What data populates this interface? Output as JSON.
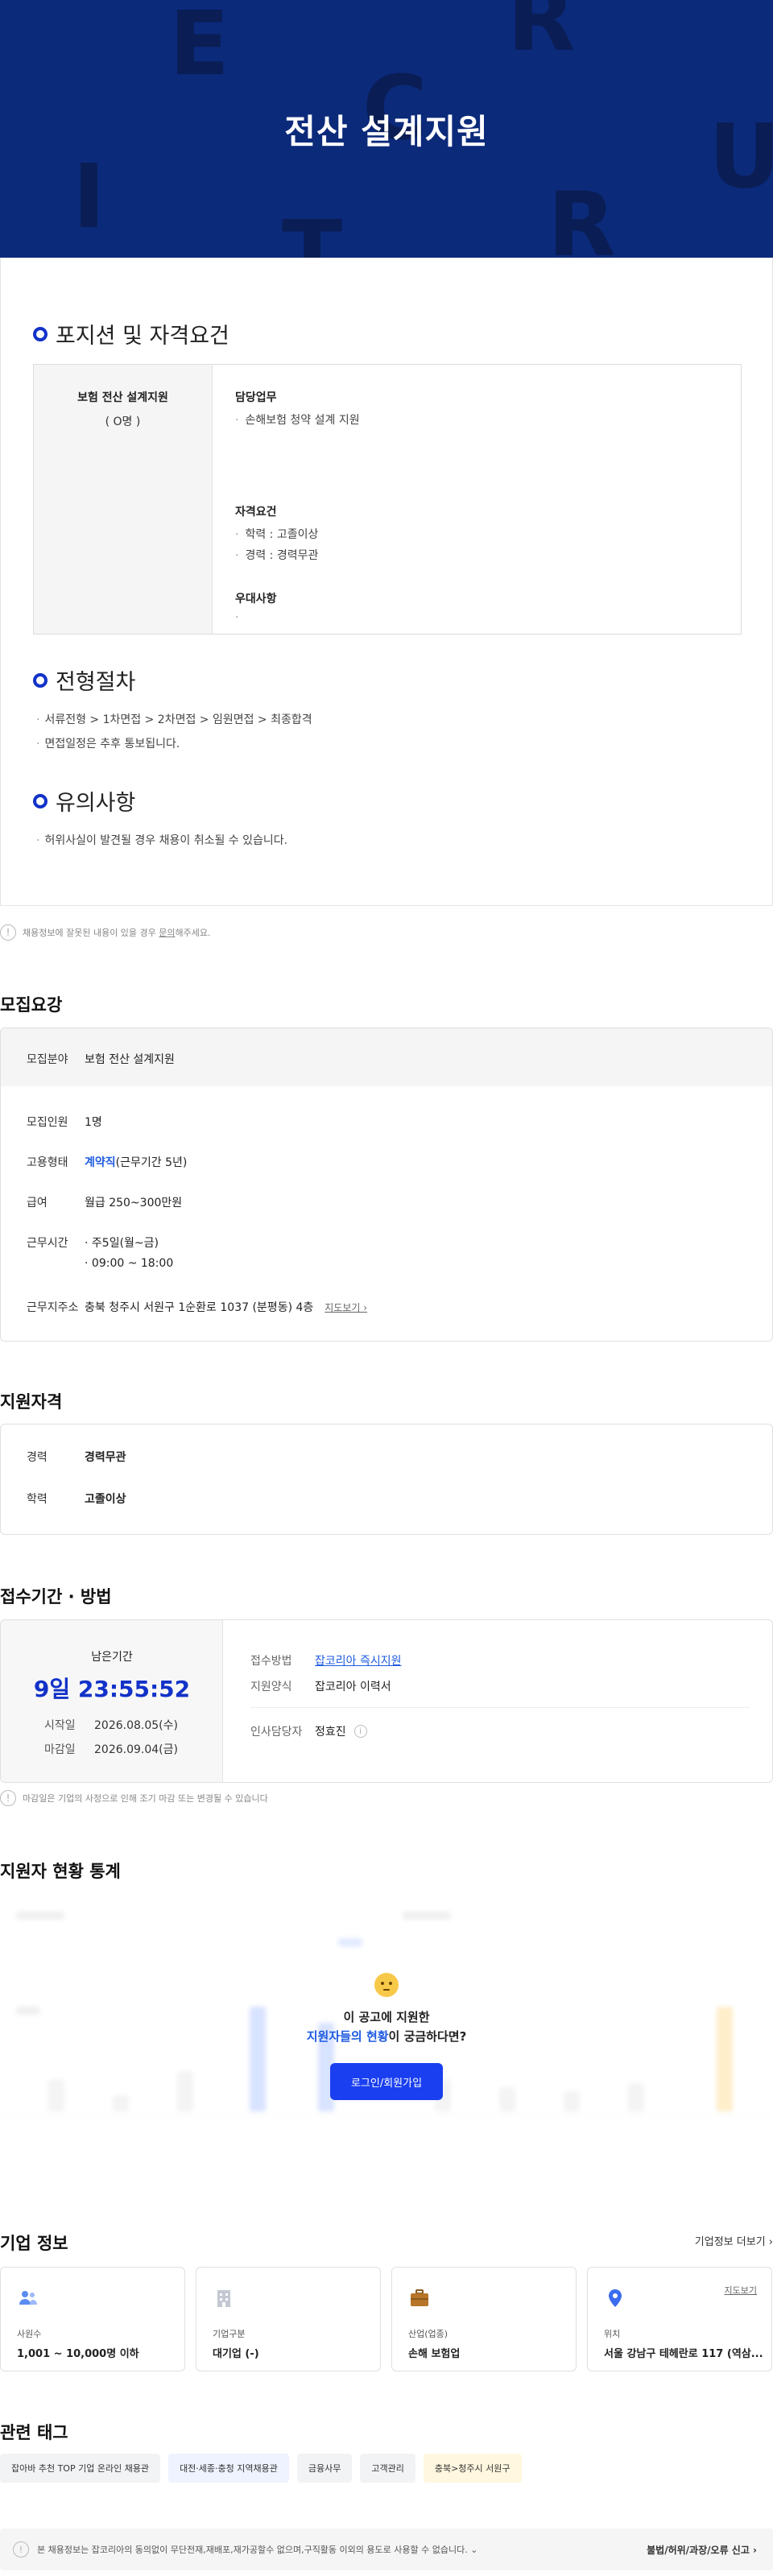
{
  "hero": {
    "title": "전산 설계지원",
    "bg_letters": [
      "E",
      "R",
      "C",
      "U",
      "I",
      "R",
      "T"
    ]
  },
  "position": {
    "section_title": "포지션 및 자격요건",
    "name": "보험 전산 설계지원",
    "count": "( O명 )",
    "duty_title": "담당업무",
    "duties": [
      "손해보험 청약 설계 지원"
    ],
    "qual_title": "자격요건",
    "quals": [
      "학력 : 고졸이상",
      "경력 : 경력무관"
    ],
    "pref_title": "우대사항",
    "prefs": [
      ""
    ]
  },
  "process": {
    "section_title": "전형절차",
    "items": [
      "서류전형 > 1차면접 > 2차면접 > 임원면접 > 최종합격",
      "면접일정은 추후 통보됩니다."
    ]
  },
  "caution": {
    "section_title": "유의사항",
    "items": [
      "허위사실이 발견될 경우 채용이 취소될 수 있습니다."
    ]
  },
  "report_notice": {
    "text": "채용정보에 잘못된 내용이 있을 경우",
    "link": "문의",
    "suffix": "해주세요."
  },
  "recruit": {
    "title": "모집요강",
    "field_label": "모집분야",
    "field_value": "보험 전산 설계지원",
    "count_label": "모집인원",
    "count_value": "1명",
    "type_label": "고용형태",
    "type_value": "계약직",
    "type_note": "(근무기간 5년)",
    "salary_label": "급여",
    "salary_value": "월급 250~300만원",
    "hours_label": "근무시간",
    "hours_days": "주5일(월~금)",
    "hours_time": "09:00 ~ 18:00",
    "place_label": "근무지주소",
    "place_value": "충북 청주시 서원구 1순환로 1037 (분평동) 4층",
    "map_link": "지도보기"
  },
  "qualification": {
    "title": "지원자격",
    "career_label": "경력",
    "career_value": "경력무관",
    "edu_label": "학력",
    "edu_value": "고졸이상"
  },
  "apply": {
    "title": "접수기간 · 방법",
    "remain_label": "남은기간",
    "remain_value": "9일 23:55:52",
    "start_label": "시작일",
    "start_value": "2026.08.05(수)",
    "end_label": "마감일",
    "end_value": "2026.09.04(금)",
    "method_label": "접수방법",
    "method_value": "잡코리아 즉시지원",
    "form_label": "지원양식",
    "form_value": "잡코리아 이력서",
    "hr_label": "인사담당자",
    "hr_value": "정효진",
    "notice": "마감일은 기업의 사정으로 인해 조기 마감 또는 변경될 수 있습니다"
  },
  "stats": {
    "title": "지원자 현황 통계",
    "overlay_line1": "이 공고에 지원한",
    "overlay_hl": "지원자들의 현황",
    "overlay_line2": "이 궁금하다면?",
    "login_button": "로그인/회원가입"
  },
  "company": {
    "title": "기업 정보",
    "more": "기업정보 더보기",
    "cards": [
      {
        "label": "사원수",
        "value": "1,001 ~ 10,000명 이하",
        "icon": "people-icon"
      },
      {
        "label": "기업구분",
        "value": "대기업 (-)",
        "icon": "building-icon"
      },
      {
        "label": "산업(업종)",
        "value": "손해 보험업",
        "icon": "briefcase-icon"
      },
      {
        "label": "위치",
        "value": "서울 강남구 테헤란로 117 (역삼...",
        "icon": "location-pin-icon",
        "map_link": "지도보기"
      }
    ]
  },
  "tags": {
    "title": "관련 태그",
    "items": [
      "잡아바 추천 TOP 기업 온라인 채용관",
      "대전·세종·충청 지역채용관",
      "금융사무",
      "고객관리",
      "충북>청주시 서원구"
    ]
  },
  "footer": {
    "text": "본 채용정보는 잡코리아의 동의없이 무단전재,재배포,재가공할수 없으며,구직활동 이외의 용도로 사용할 수 없습니다.",
    "report": "불법/허위/과장/오류 신고"
  },
  "colors": {
    "hero_bg": "#0c2a7a",
    "accent": "#1e5be0",
    "button": "#1a3ff0"
  }
}
